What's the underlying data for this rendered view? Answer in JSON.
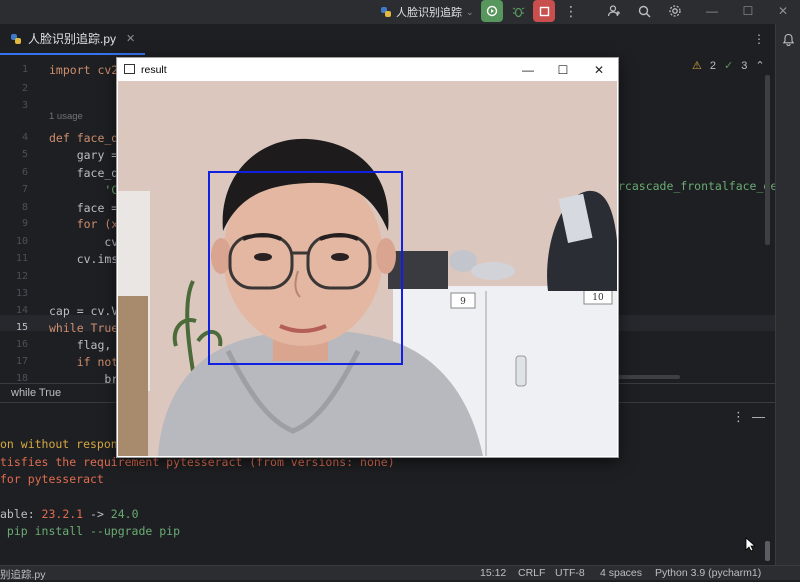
{
  "toolbar": {
    "run_config": "人脸识别追踪",
    "icons": [
      "python-icon",
      "chevron-down-icon",
      "run-icon",
      "debug-icon",
      "stop-icon",
      "more-icon",
      "add-user-icon",
      "search-icon",
      "gear-icon",
      "minimize-icon",
      "maximize-icon",
      "close-icon"
    ]
  },
  "tab": {
    "label": "人脸识别追踪.py"
  },
  "editor": {
    "inspections": {
      "warnings": "2",
      "ok": "3"
    },
    "usage_hint": "1 usage",
    "lines": [
      {
        "n": "1",
        "text": "import cv2"
      },
      {
        "n": "2",
        "text": ""
      },
      {
        "n": "3",
        "text": ""
      },
      {
        "n": "4",
        "text": "def face_de"
      },
      {
        "n": "5",
        "text": "    gary = "
      },
      {
        "n": "6",
        "text": "    face_de"
      },
      {
        "n": "7",
        "text": "        'C:"
      },
      {
        "n": "8",
        "text": "    face = "
      },
      {
        "n": "9",
        "text": "    for (x,"
      },
      {
        "n": "10",
        "text": "        cv."
      },
      {
        "n": "11",
        "text": "    cv.imsh"
      },
      {
        "n": "12",
        "text": ""
      },
      {
        "n": "13",
        "text": ""
      },
      {
        "n": "14",
        "text": "cap = cv.Vi"
      },
      {
        "n": "15",
        "text": "while True:"
      },
      {
        "n": "16",
        "text": "    flag, f"
      },
      {
        "n": "17",
        "text": "    if not"
      },
      {
        "n": "18",
        "text": "        bre"
      }
    ],
    "line7_tail": "rcascade_frontalface_defa"
  },
  "breadcrumb": "while True",
  "run_output": [
    {
      "text": "on without response",
      "kind": "warn"
    },
    {
      "text": "tisfies the requirement pytesseract (from versions: none)",
      "kind": "err"
    },
    {
      "text": "for pytesseract",
      "kind": "err"
    },
    {
      "text": "",
      "kind": "plain"
    },
    {
      "text": "able: ",
      "kind": "plain",
      "v1": "23.2.1",
      "arrow": " -> ",
      "v2": "24.0"
    },
    {
      "text": " pip install --upgrade pip",
      "kind": "ok"
    }
  ],
  "statusbar": {
    "file": "别追踪.py",
    "position": "15:12",
    "line_sep": "CRLF",
    "encoding": "UTF-8",
    "indent": "4 spaces",
    "interpreter": "Python 3.9 (pycharm1)"
  },
  "result_window": {
    "title": "result",
    "cabinet_labels": [
      "9",
      "10"
    ]
  }
}
